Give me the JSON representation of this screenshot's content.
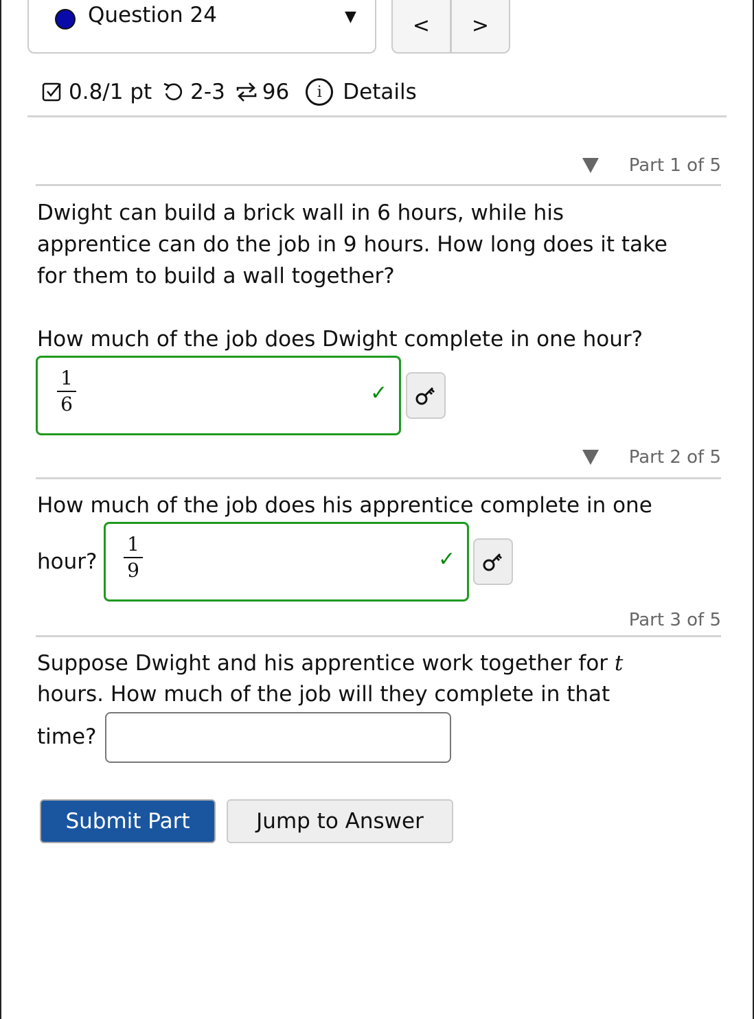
{
  "header": {
    "question_title": "Question 24",
    "status_dot_color": "#0a0aa8",
    "prev_label": "<",
    "next_label": ">"
  },
  "meta": {
    "score": "0.8/1 pt",
    "attempts": "2-3",
    "retries": "96",
    "details_label": "Details",
    "icons": [
      "checkbox-icon",
      "undo-icon",
      "repeat-icon",
      "info-icon"
    ]
  },
  "problem": {
    "line1": "Dwight can build a brick wall in 6 hours, while his",
    "line2": "apprentice can do the job in 9 hours. How long does it take",
    "line3": "for them to build a wall together?"
  },
  "parts": [
    {
      "label": "Part 1 of 5",
      "question": "How much of the job does Dwight complete in one hour?",
      "answer": {
        "numerator": "1",
        "denominator": "6"
      },
      "status": "correct"
    },
    {
      "label": "Part 2 of 5",
      "question_a": "How much of the job does his apprentice complete in one",
      "question_b": "hour?",
      "answer": {
        "numerator": "1",
        "denominator": "9"
      },
      "status": "correct"
    },
    {
      "label": "Part 3 of 5",
      "question_a": "Suppose Dwight and his apprentice work together for ",
      "variable": "t",
      "question_b": "hours. How much of the job will they complete in that",
      "question_c": "time?",
      "answer_value": ""
    }
  ],
  "buttons": {
    "submit": "Submit Part",
    "jump": "Jump to Answer"
  },
  "colors": {
    "correct": "#1f9a1f",
    "primary": "#1a56a0"
  }
}
